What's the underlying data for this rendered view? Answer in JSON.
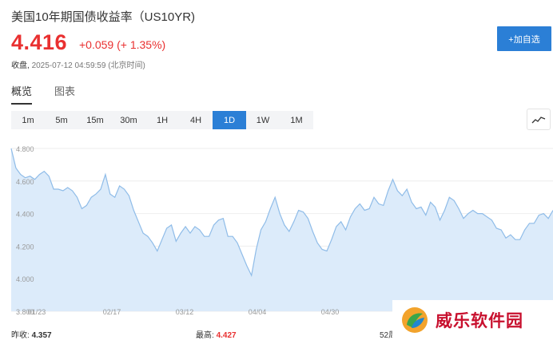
{
  "header": {
    "title": "美国10年期国债收益率（US10YR)",
    "price": "4.416",
    "change": "+0.059 (+ 1.35%)",
    "timestamp_label": "收盘,",
    "timestamp": "2025-07-12 04:59:59 (北京时间)",
    "add_watchlist": "+加自选"
  },
  "tabs": [
    {
      "label": "概览",
      "active": true
    },
    {
      "label": "图表",
      "active": false
    }
  ],
  "periods": [
    {
      "label": "1m",
      "active": false
    },
    {
      "label": "5m",
      "active": false
    },
    {
      "label": "15m",
      "active": false
    },
    {
      "label": "30m",
      "active": false
    },
    {
      "label": "1H",
      "active": false
    },
    {
      "label": "4H",
      "active": false
    },
    {
      "label": "1D",
      "active": true
    },
    {
      "label": "1W",
      "active": false
    },
    {
      "label": "1M",
      "active": false
    }
  ],
  "chart_type_icon": "line-chart-icon",
  "colors": {
    "up": "#e93030",
    "accent": "#2b7fd6",
    "area_fill": "#dcebfa",
    "line": "#8fbce8"
  },
  "chart_data": {
    "type": "area",
    "ylim": [
      3.8,
      4.8
    ],
    "yticks": [
      "3.800",
      "4.000",
      "4.200",
      "4.400",
      "4.600",
      "4.800"
    ],
    "xticks": [
      "01/23",
      "02/17",
      "03/12",
      "04/04",
      "04/30"
    ],
    "grid": true,
    "values": [
      4.8,
      4.68,
      4.64,
      4.62,
      4.63,
      4.61,
      4.64,
      4.66,
      4.63,
      4.55,
      4.55,
      4.54,
      4.56,
      4.54,
      4.5,
      4.43,
      4.45,
      4.5,
      4.52,
      4.55,
      4.64,
      4.52,
      4.5,
      4.57,
      4.55,
      4.51,
      4.42,
      4.35,
      4.28,
      4.26,
      4.22,
      4.17,
      4.24,
      4.31,
      4.33,
      4.23,
      4.28,
      4.32,
      4.28,
      4.32,
      4.3,
      4.26,
      4.26,
      4.33,
      4.36,
      4.37,
      4.26,
      4.26,
      4.22,
      4.15,
      4.08,
      4.02,
      4.18,
      4.3,
      4.35,
      4.43,
      4.5,
      4.4,
      4.33,
      4.29,
      4.35,
      4.42,
      4.41,
      4.37,
      4.29,
      4.22,
      4.18,
      4.17,
      4.24,
      4.32,
      4.35,
      4.3,
      4.38,
      4.43,
      4.46,
      4.42,
      4.43,
      4.5,
      4.46,
      4.45,
      4.54,
      4.61,
      4.54,
      4.51,
      4.55,
      4.47,
      4.43,
      4.44,
      4.39,
      4.47,
      4.44,
      4.36,
      4.42,
      4.5,
      4.48,
      4.43,
      4.37,
      4.4,
      4.42,
      4.4,
      4.4,
      4.38,
      4.36,
      4.31,
      4.3,
      4.25,
      4.27,
      4.24,
      4.24,
      4.3,
      4.34,
      4.34,
      4.39,
      4.4,
      4.37,
      4.42
    ]
  },
  "stats": [
    {
      "label": "昨收:",
      "value": "4.357",
      "red": false
    },
    {
      "label": "最高:",
      "value": "4.427",
      "red": true
    },
    {
      "label": "52周",
      "value": "",
      "red": false
    }
  ],
  "watermark": {
    "text": "威乐软件园"
  }
}
